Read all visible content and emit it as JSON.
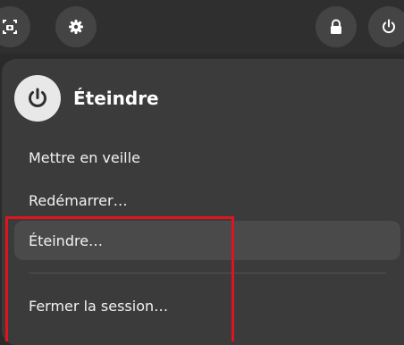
{
  "top_bar": {
    "icons": [
      "screenshot-icon",
      "gear-icon",
      "lock-icon",
      "power-icon"
    ]
  },
  "power_menu": {
    "title": "Éteindre",
    "items": [
      {
        "label": "Mettre en veille"
      },
      {
        "label": "Redémarrer…"
      },
      {
        "label": "Éteindre…"
      },
      {
        "label": "Fermer la session…"
      }
    ]
  },
  "colors": {
    "background": "#2a2a2a",
    "panel": "#3b3b3b",
    "hover_item": "#4a4a4a",
    "highlight_box": "#e0141e"
  }
}
